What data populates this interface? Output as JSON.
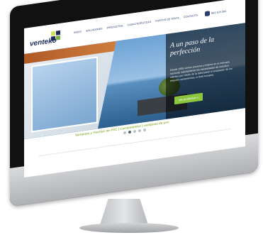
{
  "site": {
    "logo_text": "venteko",
    "nav": [
      "INICIO",
      "SOLUCIONES",
      "PRODUCTOS",
      "CARACTERÍSTICAS",
      "PUNTOS DE VENTA",
      "CONTACTO"
    ],
    "phone_text": "902 424 364",
    "hero": {
      "title": "A un paso de la perfección",
      "text": "Desde 1995 somos pioneros y líderes en el mercado nacional, satisfaciendo las necesidades de nuestros clientes por medio de la fabricación e instalación de los mejores cerramientos, a nivel europeo.",
      "cta": "Ver productos »"
    },
    "tagline": "Ventanas y Puertas de PVC | Cerramientos | ventanas de pvc",
    "slider": {
      "count": 5,
      "active_index": 1
    }
  },
  "device": {
    "brand_icon": "apple-logo-icon"
  }
}
